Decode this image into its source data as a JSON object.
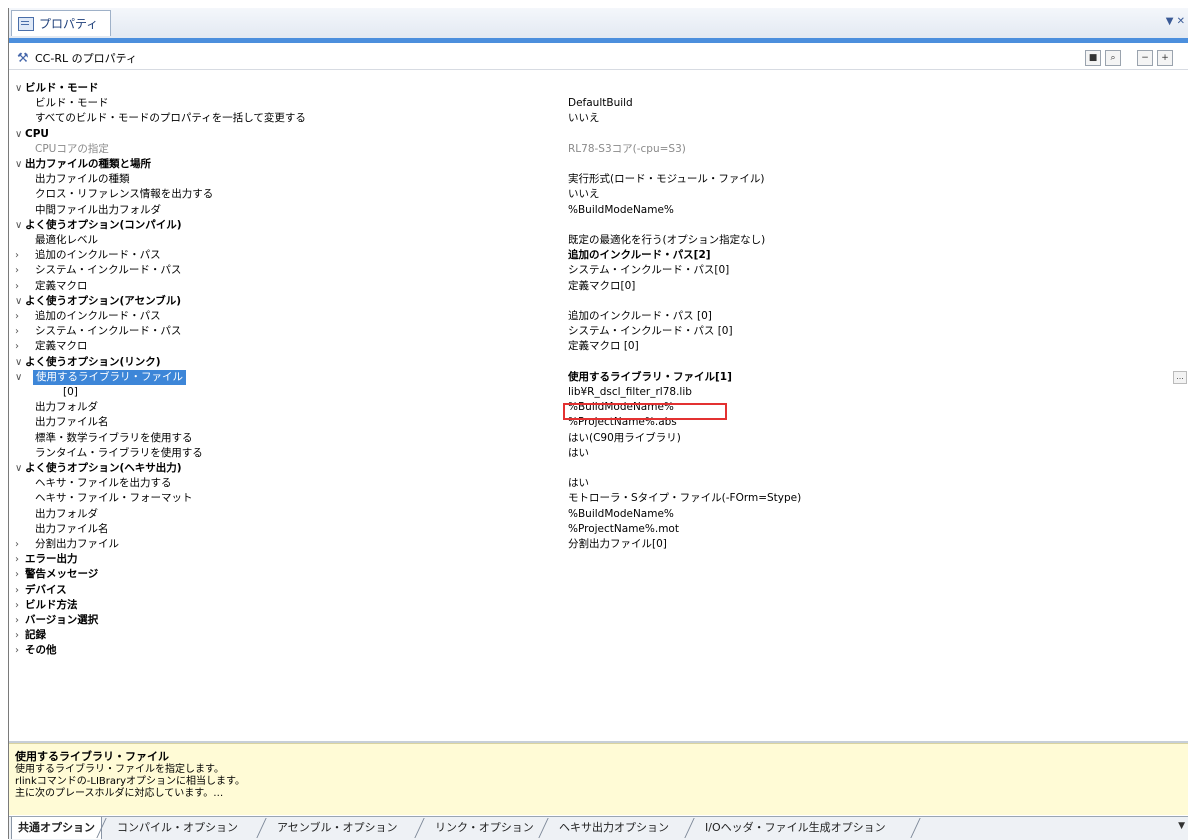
{
  "window": {
    "tab_title": "プロパティ",
    "header_title": "CC-RL のプロパティ"
  },
  "rows": [
    {
      "kind": "cat",
      "expander": "∨",
      "name": "ビルド・モード",
      "value": ""
    },
    {
      "kind": "prop",
      "expander": "",
      "name": "ビルド・モード",
      "value": "DefaultBuild"
    },
    {
      "kind": "prop",
      "expander": "",
      "name": "すべてのビルド・モードのプロパティを一括して変更する",
      "value": "いいえ"
    },
    {
      "kind": "cat",
      "expander": "∨",
      "name": "CPU",
      "value": ""
    },
    {
      "kind": "gray",
      "expander": "",
      "name": "CPUコアの指定",
      "value": "RL78-S3コア(-cpu=S3)"
    },
    {
      "kind": "cat",
      "expander": "∨",
      "name": "出力ファイルの種類と場所",
      "value": ""
    },
    {
      "kind": "prop",
      "expander": "",
      "name": "出力ファイルの種類",
      "value": "実行形式(ロード・モジュール・ファイル)"
    },
    {
      "kind": "prop",
      "expander": "",
      "name": "クロス・リファレンス情報を出力する",
      "value": "いいえ"
    },
    {
      "kind": "prop",
      "expander": "",
      "name": "中間ファイル出力フォルダ",
      "value": "%BuildModeName%"
    },
    {
      "kind": "cat",
      "expander": "∨",
      "name": "よく使うオプション(コンパイル)",
      "value": ""
    },
    {
      "kind": "prop",
      "expander": "",
      "name": "最適化レベル",
      "value": "既定の最適化を行う(オプション指定なし)"
    },
    {
      "kind": "bold",
      "expander": "›",
      "name": "追加のインクルード・パス",
      "value": "追加のインクルード・パス[2]"
    },
    {
      "kind": "prop",
      "expander": "›",
      "name": "システム・インクルード・パス",
      "value": "システム・インクルード・パス[0]"
    },
    {
      "kind": "prop",
      "expander": "›",
      "name": "定義マクロ",
      "value": "定義マクロ[0]"
    },
    {
      "kind": "cat",
      "expander": "∨",
      "name": "よく使うオプション(アセンブル)",
      "value": ""
    },
    {
      "kind": "prop",
      "expander": "›",
      "name": "追加のインクルード・パス",
      "value": "追加のインクルード・パス [0]"
    },
    {
      "kind": "prop",
      "expander": "›",
      "name": "システム・インクルード・パス",
      "value": "システム・インクルード・パス [0]"
    },
    {
      "kind": "prop",
      "expander": "›",
      "name": "定義マクロ",
      "value": "定義マクロ [0]"
    },
    {
      "kind": "cat",
      "expander": "∨",
      "name": "よく使うオプション(リンク)",
      "value": ""
    },
    {
      "kind": "sel",
      "expander": "∨",
      "name": "使用するライブラリ・ファイル",
      "value": "使用するライブラリ・ファイル[1]",
      "ellipsis": "..."
    },
    {
      "kind": "child",
      "expander": "",
      "name": "[0]",
      "value": "lib¥R_dscl_filter_rl78.lib"
    },
    {
      "kind": "prop",
      "expander": "",
      "name": "出力フォルダ",
      "value": "%BuildModeName%"
    },
    {
      "kind": "prop",
      "expander": "",
      "name": "出力ファイル名",
      "value": "%ProjectName%.abs"
    },
    {
      "kind": "prop",
      "expander": "",
      "name": "標準・数学ライブラリを使用する",
      "value": "はい(C90用ライブラリ)"
    },
    {
      "kind": "prop",
      "expander": "",
      "name": "ランタイム・ライブラリを使用する",
      "value": "はい"
    },
    {
      "kind": "cat",
      "expander": "∨",
      "name": "よく使うオプション(ヘキサ出力)",
      "value": ""
    },
    {
      "kind": "prop",
      "expander": "",
      "name": "ヘキサ・ファイルを出力する",
      "value": "はい"
    },
    {
      "kind": "prop",
      "expander": "",
      "name": "ヘキサ・ファイル・フォーマット",
      "value": "モトローラ・Sタイプ・ファイル(-FOrm=Stype)"
    },
    {
      "kind": "prop",
      "expander": "",
      "name": "出力フォルダ",
      "value": "%BuildModeName%"
    },
    {
      "kind": "prop",
      "expander": "",
      "name": "出力ファイル名",
      "value": "%ProjectName%.mot"
    },
    {
      "kind": "prop",
      "expander": "›",
      "name": "分割出力ファイル",
      "value": "分割出力ファイル[0]"
    },
    {
      "kind": "cat",
      "expander": "›",
      "name": "エラー出力",
      "value": ""
    },
    {
      "kind": "cat",
      "expander": "›",
      "name": "警告メッセージ",
      "value": ""
    },
    {
      "kind": "cat",
      "expander": "›",
      "name": "デバイス",
      "value": ""
    },
    {
      "kind": "cat",
      "expander": "›",
      "name": "ビルド方法",
      "value": ""
    },
    {
      "kind": "cat",
      "expander": "›",
      "name": "バージョン選択",
      "value": ""
    },
    {
      "kind": "cat",
      "expander": "›",
      "name": "記録",
      "value": ""
    },
    {
      "kind": "cat",
      "expander": "›",
      "name": "その他",
      "value": ""
    }
  ],
  "description": {
    "title": "使用するライブラリ・ファイル",
    "lines": [
      "使用するライブラリ・ファイルを指定します。",
      "rlinkコマンドの-LIBraryオプションに相当します。",
      "主に次のプレースホルダに対応しています。…"
    ]
  },
  "tabs": [
    {
      "label": "共通オプション",
      "active": true
    },
    {
      "label": "コンパイル・オプション",
      "active": false
    },
    {
      "label": "アセンブル・オプション",
      "active": false
    },
    {
      "label": "リンク・オプション",
      "active": false
    },
    {
      "label": "ヘキサ出力オプション",
      "active": false
    },
    {
      "label": "I/Oヘッダ・ファイル生成オプション",
      "active": false
    }
  ],
  "colors": {
    "selection": "#3d86d8",
    "accent": "#4c8fdd",
    "highlight_box": "#e33131",
    "description_bg": "#fffbd6"
  }
}
